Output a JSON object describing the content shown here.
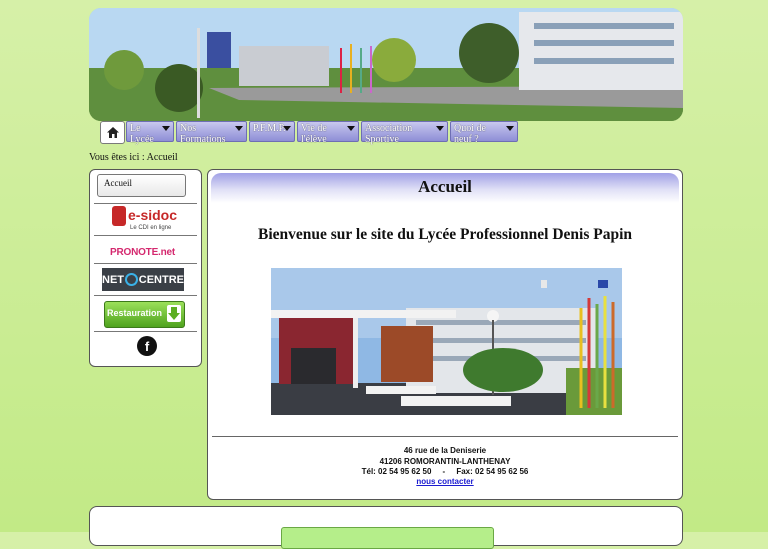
{
  "nav": {
    "home_icon": "house-icon",
    "items": [
      {
        "label": "Le Lycée"
      },
      {
        "label": "Nos Formations"
      },
      {
        "label": "P.F.M.P."
      },
      {
        "label": "Vie de l'élève"
      },
      {
        "label": "Association Sportive"
      },
      {
        "label": "Quoi de neuf ?"
      }
    ]
  },
  "breadcrumb": "Vous êtes ici : Accueil",
  "sidebar": {
    "home_label": "Accueil",
    "esidoc": {
      "main": "e-sidoc",
      "sub": "Le CDI en ligne"
    },
    "pronote": "PRONOTE.net",
    "netocentre": {
      "left": "NET",
      "right": "CENTRE"
    },
    "restauration": "Restauration",
    "facebook": "f"
  },
  "content": {
    "title": "Accueil",
    "welcome": "Bienvenue sur le site du Lycée Professionnel Denis Papin",
    "address_line1": "46 rue de la Deniserie",
    "address_line2": "41206 ROMORANTIN-LANTHENAY",
    "phone_fax": "Tél: 02 54 95 62 50     -     Fax: 02 54 95 62 56",
    "contact_link": "nous contacter"
  },
  "colors": {
    "page_bg": "#c8ec90",
    "menu": "#9a9ade",
    "link": "#1a1ad0"
  }
}
